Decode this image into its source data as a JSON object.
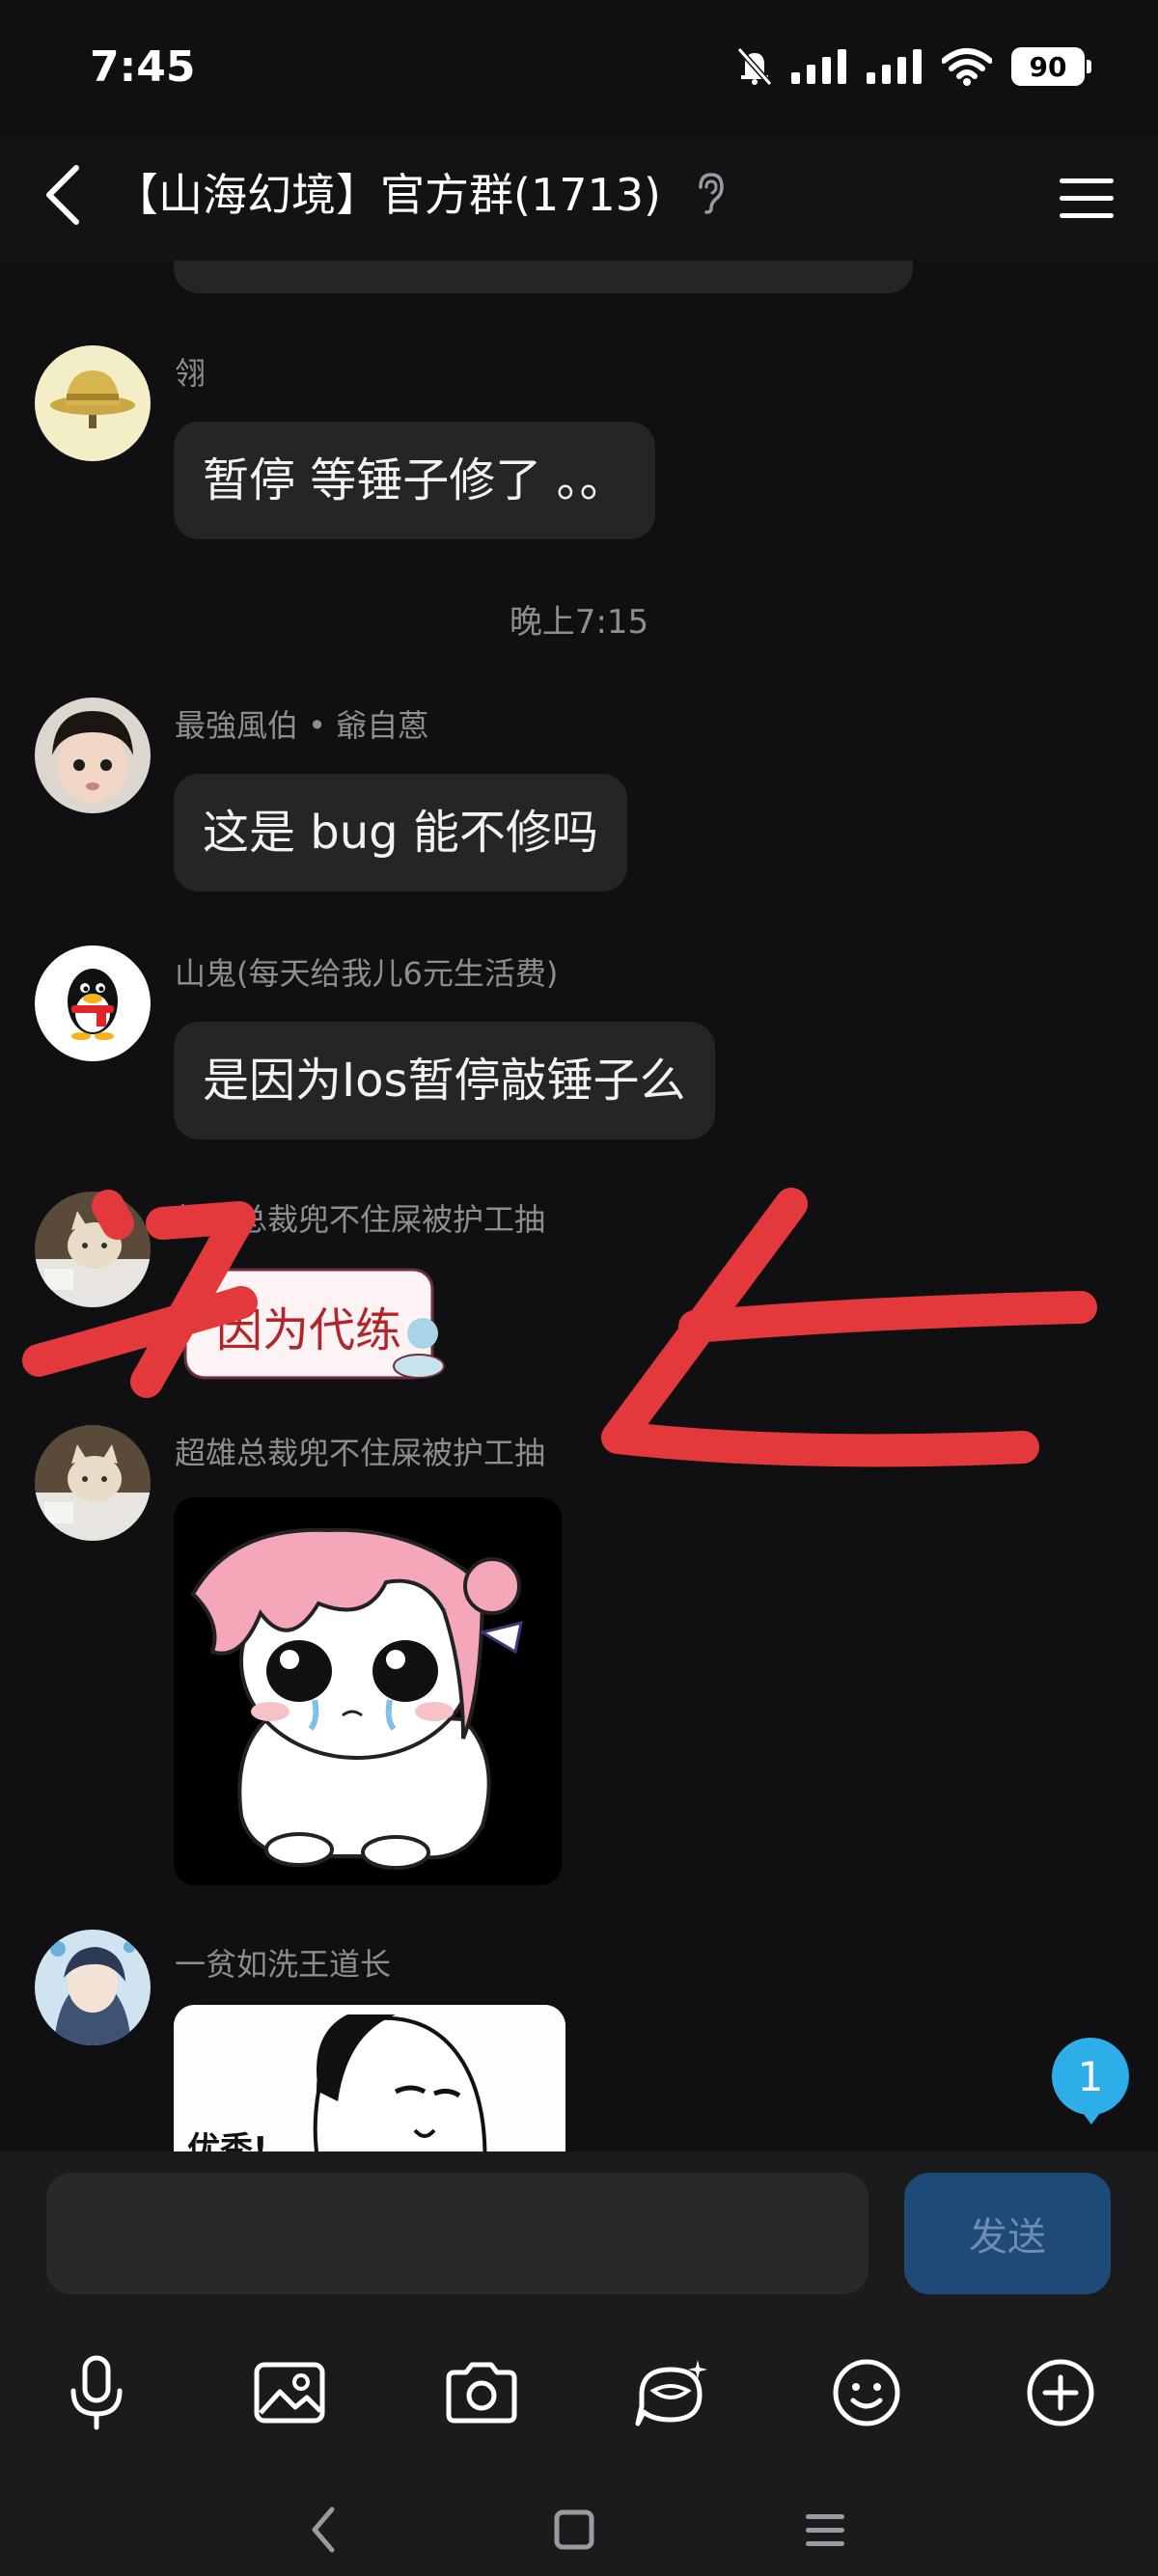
{
  "status_bar": {
    "time": "7:45",
    "battery": "90",
    "icons": [
      "mute-bell-icon",
      "signal-icon",
      "signal-icon",
      "wifi-icon",
      "battery-icon"
    ]
  },
  "header": {
    "title": "【山海幻境】官方群(1713)",
    "back_icon": "back-arrow-icon",
    "ear_icon": "ear-icon",
    "menu_icon": "hamburger-menu-icon"
  },
  "messages": [
    {
      "sender": "翎",
      "text": "暂停 等锤子修了 。。",
      "avatar": "yellow-hat-avatar"
    },
    {
      "timestamp": "晚上7:15"
    },
    {
      "sender": "最強風伯 • 爺自蒽",
      "text": "这是 bug 能不修吗",
      "avatar": "child-avatar"
    },
    {
      "sender": "山鬼(每天给我儿6元生活费)",
      "text": "是因为Ios暂停敲锤子么",
      "avatar": "penguin-avatar"
    },
    {
      "sender": "超雄总裁兜不住屎被护工抽",
      "sticker_text": "因为代练",
      "avatar": "cat-avatar"
    },
    {
      "sender": "超雄总裁兜不住屎被护工抽",
      "sticker": "crying-pink-hair-sticker",
      "avatar": "cat-avatar"
    },
    {
      "sender": "一贫如洗王道长",
      "sticker_text": "优秀!",
      "sticker": "panda-meme-sticker",
      "avatar": "anime-avatar"
    }
  ],
  "unread_badge": "1",
  "composer": {
    "placeholder": "",
    "send_label": "发送"
  },
  "toolbar": [
    "microphone-icon",
    "image-icon",
    "camera-icon",
    "red-packet-icon",
    "emoji-icon",
    "plus-icon"
  ],
  "navbar": [
    "nav-back-icon",
    "nav-home-icon",
    "nav-recents-icon"
  ],
  "colors": {
    "background": "#101013",
    "bubble": "#252528",
    "send_button": "#1e4a78",
    "badge": "#2eaee9",
    "annotation": "#e3383c"
  }
}
